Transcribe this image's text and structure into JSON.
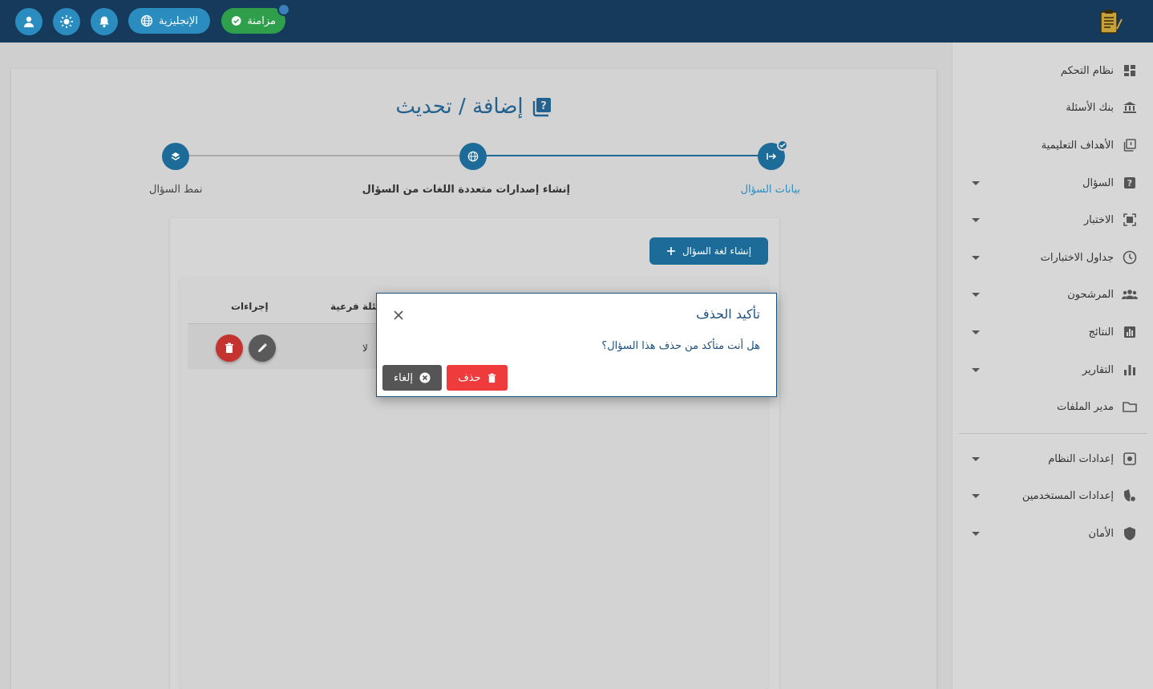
{
  "topbar": {
    "sync_label": "مزامنة",
    "language_label": "الإنجليزية",
    "icons": [
      "user-icon",
      "brightness-icon",
      "bell-icon",
      "globe-icon",
      "check-circle-icon"
    ]
  },
  "sidebar": {
    "items": [
      {
        "label": "نظام التحكم",
        "icon": "dashboard-icon",
        "has_caret": false
      },
      {
        "label": "بنك الأسئلة",
        "icon": "bank-icon",
        "has_caret": false
      },
      {
        "label": "الأهداف التعليمية",
        "icon": "objectives-icon",
        "has_caret": false
      },
      {
        "label": "السؤال",
        "icon": "question-icon",
        "has_caret": true
      },
      {
        "label": "الاختبار",
        "icon": "exam-icon",
        "has_caret": true
      },
      {
        "label": "جداول الاختبارات",
        "icon": "clock-icon",
        "has_caret": true
      },
      {
        "label": "المرشحون",
        "icon": "people-icon",
        "has_caret": true
      },
      {
        "label": "النتائج",
        "icon": "results-icon",
        "has_caret": true
      },
      {
        "label": "التقارير",
        "icon": "reports-icon",
        "has_caret": true
      },
      {
        "label": "مدير الملفات",
        "icon": "folder-icon",
        "has_caret": false
      },
      {
        "label": "إعدادات النظام",
        "icon": "system-settings-icon",
        "has_caret": true
      },
      {
        "label": "إعدادات المستخدمين",
        "icon": "user-settings-icon",
        "has_caret": true
      },
      {
        "label": "الأمان",
        "icon": "shield-icon",
        "has_caret": true
      }
    ]
  },
  "main": {
    "title": "إضافة / تحديث",
    "steps": [
      {
        "label": "بيانات السؤال",
        "icon": "arrow-icon",
        "state": "completed"
      },
      {
        "label": "إنشاء إصدارات متعددة اللغات من السؤال",
        "icon": "globe-icon",
        "state": "active"
      },
      {
        "label": "نمط السؤال",
        "icon": "layers-icon",
        "state": "pending"
      }
    ],
    "create_button": "إنشاء لغة السؤال",
    "table": {
      "headers": [
        "أسئلة فرعية",
        "إجراءات"
      ],
      "rows": [
        {
          "sub_questions": "لا"
        }
      ]
    }
  },
  "dialog": {
    "title": "تأكيد الحذف",
    "message": "هل أنت متأكد من حذف هذا السؤال؟",
    "delete_label": "حذف",
    "cancel_label": "إلغاء"
  },
  "colors": {
    "topbar": "#163a5c",
    "accent": "#1d6b98",
    "sync": "#2f9f4c",
    "danger": "#ef3b3b",
    "cancel": "#555555"
  }
}
